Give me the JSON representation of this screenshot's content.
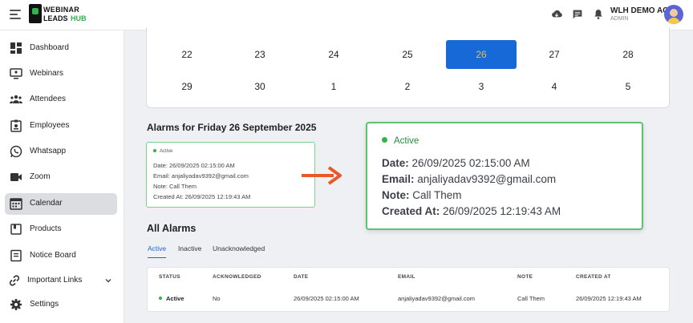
{
  "topbar": {
    "logo_line1": "WEBINAR",
    "logo_line2": "LEADS",
    "logo_line3": "HUB",
    "icons": [
      "cloud-download-icon",
      "chat-icon",
      "bell-icon"
    ],
    "user_name": "WLH DEMO AC",
    "user_role": "ADMIN"
  },
  "sidebar": {
    "items": [
      {
        "label": "Dashboard",
        "icon": "dashboard-icon"
      },
      {
        "label": "Webinars",
        "icon": "monitor-icon"
      },
      {
        "label": "Attendees",
        "icon": "people-icon"
      },
      {
        "label": "Employees",
        "icon": "badge-icon"
      },
      {
        "label": "Whatsapp",
        "icon": "whatsapp-icon"
      },
      {
        "label": "Zoom",
        "icon": "video-camera-icon"
      },
      {
        "label": "Calendar",
        "icon": "calendar-icon",
        "active": true
      },
      {
        "label": "Products",
        "icon": "product-icon"
      },
      {
        "label": "Notice Board",
        "icon": "notice-board-icon"
      },
      {
        "label": "Important Links",
        "icon": "link-icon"
      },
      {
        "label": "Settings",
        "icon": "gear-icon"
      }
    ]
  },
  "calendar": {
    "row1": [
      "22",
      "23",
      "24",
      "25",
      "26",
      "27",
      "28"
    ],
    "row2": [
      "29",
      "30",
      "1",
      "2",
      "3",
      "4",
      "5"
    ],
    "selected": "26",
    "selected_color": "#1769d8"
  },
  "alarms": {
    "title": "Alarms for Friday 26 September 2025",
    "card": {
      "status": "Active",
      "date_label": "Date:",
      "date": "26/09/2025 02:15:00 AM",
      "email_label": "Email:",
      "email": "anjaliyadav9392@gmail.com",
      "note_label": "Note:",
      "note": "Call Them",
      "created_label": "Created At:",
      "created": "26/09/2025 12:19:43 AM"
    },
    "mini_lines": {
      "date": "Date: 26/09/2025 02:15:00 AM",
      "email": "Email: anjaliyadav9392@gmail.com",
      "note": "Note: Call Them",
      "created": "Created At: 26/09/2025 12:19:43 AM"
    }
  },
  "all_alarms": {
    "title": "All Alarms",
    "tabs": [
      "Active",
      "Inactive",
      "Unacknowledged"
    ],
    "columns": [
      "STATUS",
      "ACKNOWLEDGED",
      "DATE",
      "EMAIL",
      "NOTE",
      "CREATED AT"
    ],
    "rows": [
      {
        "status": "Active",
        "acknowledged": "No",
        "date": "26/09/2025 02:15:00 AM",
        "email": "anjaliyadav9392@gmail.com",
        "note": "Call Them",
        "created": "26/09/2025 12:19:43 AM"
      }
    ]
  },
  "colors": {
    "accent": "#1769d8",
    "success": "#2fb34a",
    "arrow": "#e8582a"
  }
}
